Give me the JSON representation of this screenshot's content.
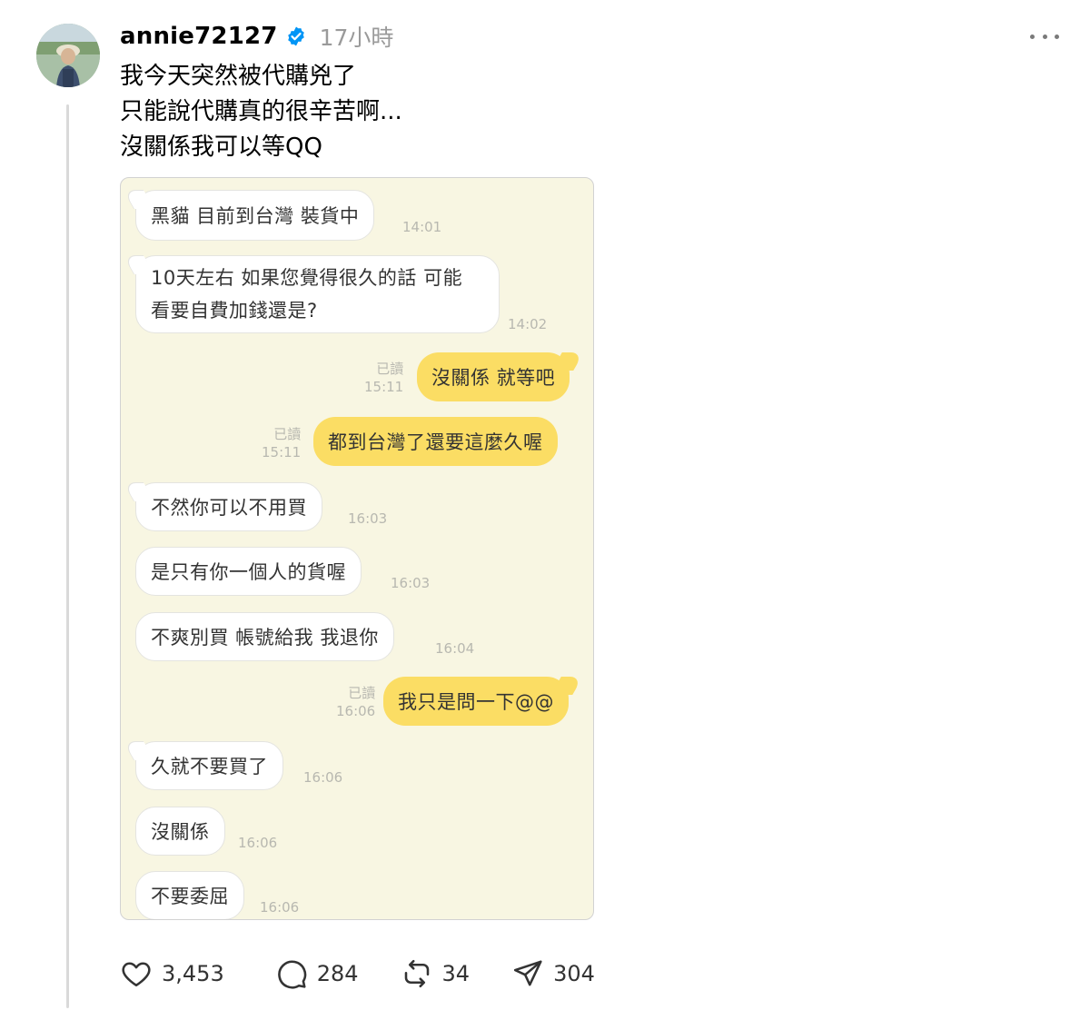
{
  "post": {
    "username": "annie72127",
    "time": "17小時",
    "caption": [
      "我今天突然被代購兇了",
      "只能說代購真的很辛苦啊...",
      "沒關係我可以等QQ"
    ]
  },
  "chat": {
    "read_label": "已讀",
    "messages": [
      {
        "side": "in",
        "text": "黑貓 目前到台灣 裝貨中",
        "time": "14:01"
      },
      {
        "side": "in",
        "text": "10天左右 如果您覺得很久的話 可能 看要自費加錢還是?",
        "time": "14:02"
      },
      {
        "side": "out",
        "text": "沒關係 就等吧",
        "time": "15:11"
      },
      {
        "side": "out",
        "text": "都到台灣了還要這麼久喔",
        "time": "15:11"
      },
      {
        "side": "in",
        "text": "不然你可以不用買",
        "time": "16:03"
      },
      {
        "side": "in",
        "text": "是只有你一個人的貨喔",
        "time": "16:03"
      },
      {
        "side": "in",
        "text": "不爽別買 帳號給我 我退你",
        "time": "16:04"
      },
      {
        "side": "out",
        "text": "我只是問一下@@",
        "time": "16:06"
      },
      {
        "side": "in",
        "text": "久就不要買了",
        "time": "16:06"
      },
      {
        "side": "in",
        "text": "沒關係",
        "time": "16:06"
      },
      {
        "side": "in",
        "text": "不要委屈",
        "time": "16:06"
      }
    ]
  },
  "actions": {
    "likes": "3,453",
    "comments": "284",
    "reposts": "34",
    "shares": "304"
  },
  "icons": {
    "verified": "verified-badge-icon",
    "like": "heart-icon",
    "comment": "comment-bubble-icon",
    "repost": "repost-icon",
    "share": "paper-plane-icon",
    "more": "more-dots-icon"
  },
  "colors": {
    "verified_blue": "#0095f6",
    "chat_background": "#f8f6e2",
    "outgoing_bubble": "#fbdd64",
    "incoming_bubble": "#ffffff"
  }
}
